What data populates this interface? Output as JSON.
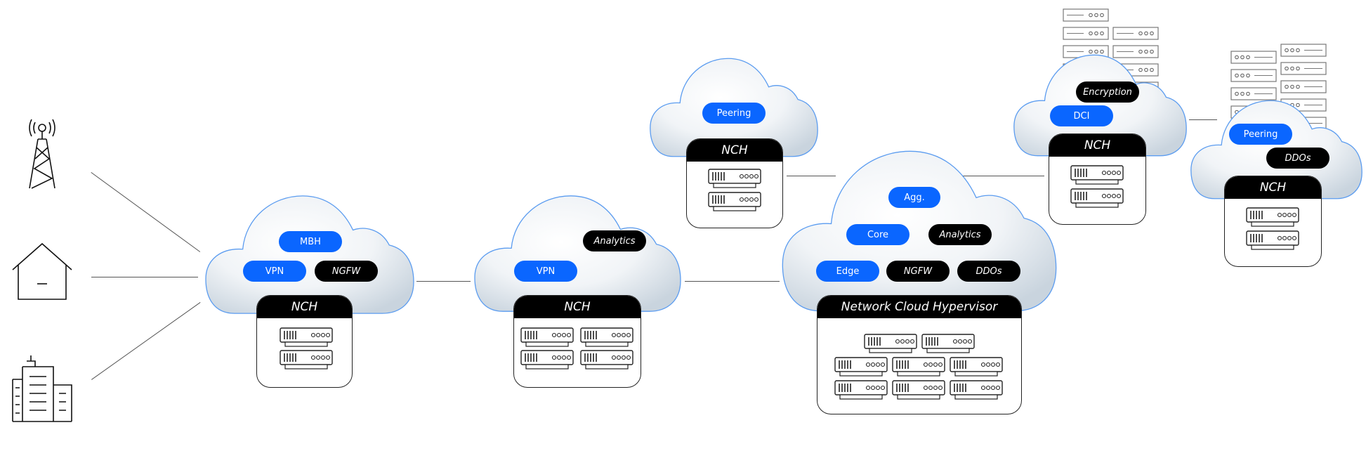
{
  "edge_sites": [
    {
      "name": "cell-tower",
      "icon": "cell-tower-icon"
    },
    {
      "name": "home",
      "icon": "house-icon"
    },
    {
      "name": "enterprise",
      "icon": "office-building-icon"
    }
  ],
  "colors": {
    "service_blue": "#0a66ff",
    "service_black": "#000000",
    "cloud_outline": "#5b9cf0"
  },
  "clouds": [
    {
      "id": "access",
      "services": [
        {
          "label": "MBH",
          "style": "blue"
        },
        {
          "label": "VPN",
          "style": "blue"
        },
        {
          "label": "NGFW",
          "style": "black"
        }
      ],
      "platform": "NCH",
      "servers": 2
    },
    {
      "id": "aggregation",
      "services": [
        {
          "label": "Analytics",
          "style": "black"
        },
        {
          "label": "VPN",
          "style": "blue"
        }
      ],
      "platform": "NCH",
      "servers": 4
    },
    {
      "id": "peering-top",
      "services": [
        {
          "label": "Peering",
          "style": "blue"
        }
      ],
      "platform": "NCH",
      "servers": 2
    },
    {
      "id": "core",
      "services": [
        {
          "label": "Agg.",
          "style": "blue"
        },
        {
          "label": "Core",
          "style": "blue"
        },
        {
          "label": "Analytics",
          "style": "black"
        },
        {
          "label": "Edge",
          "style": "blue"
        },
        {
          "label": "NGFW",
          "style": "black"
        },
        {
          "label": "DDOs",
          "style": "black"
        }
      ],
      "platform": "Network Cloud Hypervisor",
      "servers": 8
    },
    {
      "id": "dci",
      "services": [
        {
          "label": "Encryption",
          "style": "black"
        },
        {
          "label": "DCI",
          "style": "blue"
        }
      ],
      "platform": "NCH",
      "servers": 2
    },
    {
      "id": "peering-right",
      "services": [
        {
          "label": "Peering",
          "style": "blue"
        },
        {
          "label": "DDOs",
          "style": "black"
        }
      ],
      "platform": "NCH",
      "servers": 2
    }
  ]
}
